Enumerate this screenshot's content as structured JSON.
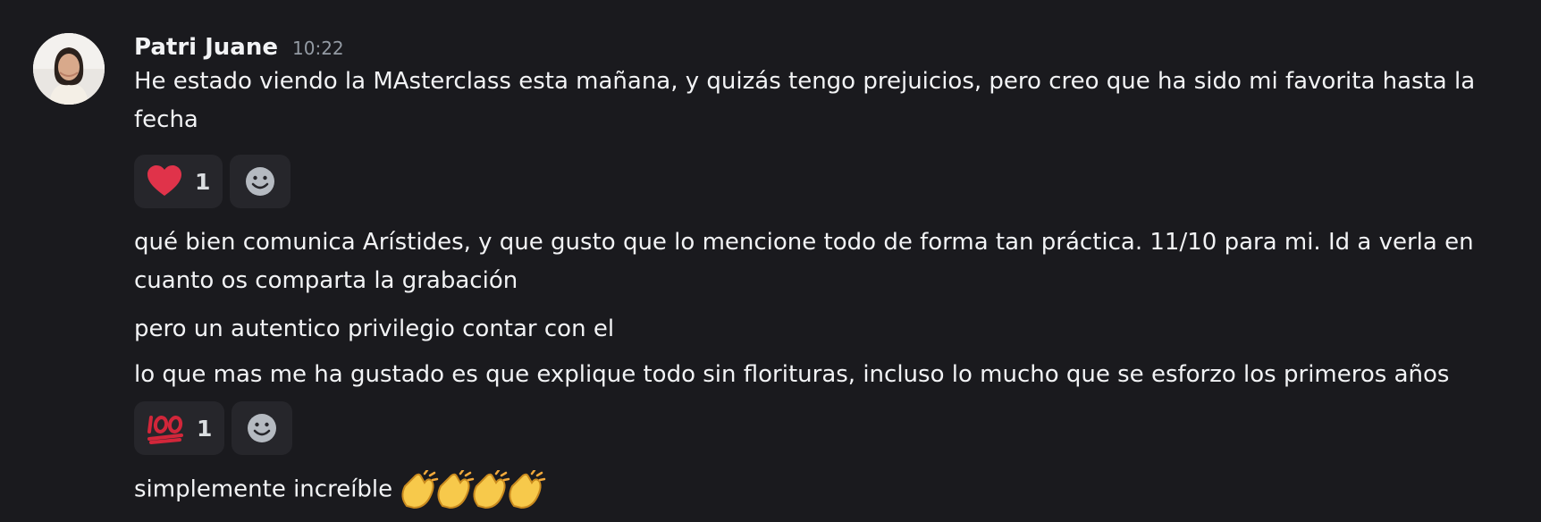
{
  "author": {
    "name": "Patri Juane",
    "timestamp": "10:22"
  },
  "messages": [
    {
      "line1": "He estado viendo la MAsterclass esta mañana, y quizás tengo prejuicios, pero creo que ha sido mi favorita hasta la",
      "line2": "fecha"
    },
    {
      "line1": "qué bien comunica Arístides, y que gusto que lo mencione todo de forma tan práctica. 11/10 para mi. Id a verla en",
      "line2": "cuanto os comparta la grabación"
    },
    {
      "line1": "pero un autentico privilegio contar con el"
    },
    {
      "line1": "lo que mas me ha gustado es que explique todo sin florituras, incluso lo mucho que se esforzo los primeros años"
    },
    {
      "line1": "simplemente increíble"
    }
  ],
  "reactions": [
    {
      "emoji": "heart-emoji",
      "count": "1"
    },
    {
      "emoji": "hundred-points-emoji",
      "count": "1"
    }
  ],
  "icons": {
    "add_reaction": "smiley-face-icon",
    "claps": "clapping-hands-emoji"
  },
  "colors": {
    "background": "#1a1a1e",
    "reaction_bg": "#26262b",
    "heart": "#e0334a",
    "hundred": "#d2263a",
    "timestamp": "#949ba4"
  }
}
